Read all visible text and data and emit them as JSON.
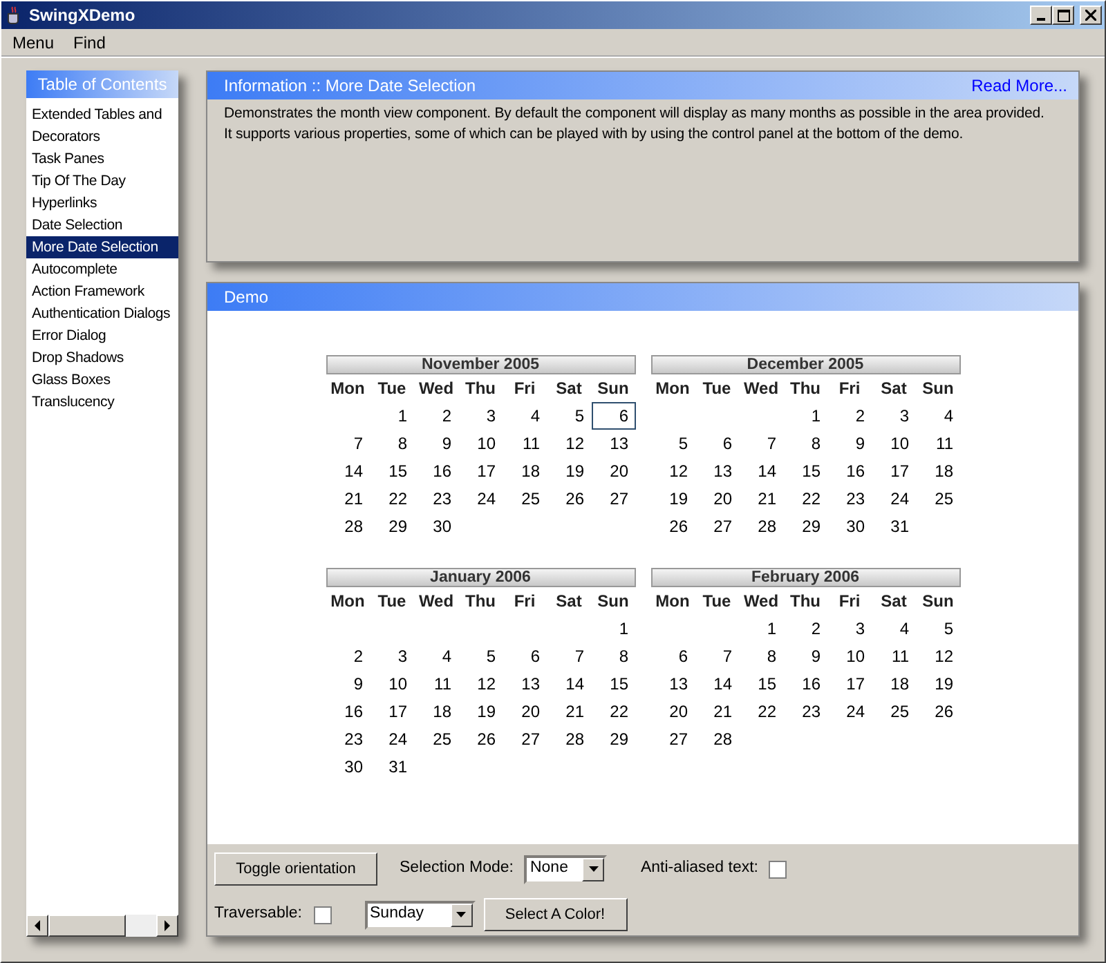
{
  "window": {
    "title": "SwingXDemo"
  },
  "menu": [
    "Menu",
    "Find"
  ],
  "sidebar": {
    "title": "Table of Contents",
    "items": [
      {
        "label": "Extended Tables and Decorators",
        "selected": false
      },
      {
        "label": "Task Panes",
        "selected": false
      },
      {
        "label": "Tip Of The Day",
        "selected": false
      },
      {
        "label": "Hyperlinks",
        "selected": false
      },
      {
        "label": "Date Selection",
        "selected": false
      },
      {
        "label": "More Date Selection",
        "selected": true
      },
      {
        "label": "Autocomplete",
        "selected": false
      },
      {
        "label": "Action Framework",
        "selected": false
      },
      {
        "label": "Authentication Dialogs",
        "selected": false
      },
      {
        "label": "Error Dialog",
        "selected": false
      },
      {
        "label": "Drop Shadows",
        "selected": false
      },
      {
        "label": "Glass Boxes",
        "selected": false
      },
      {
        "label": "Translucency",
        "selected": false
      }
    ]
  },
  "info": {
    "title": "Information :: More Date Selection",
    "link": "Read More...",
    "lines": [
      "Demonstrates the month view component. By default the component will display as many months as possible in the area provided.",
      "It supports various properties, some of which can be played with by using the control panel at the bottom of the demo."
    ]
  },
  "demo": {
    "title": "Demo",
    "months": [
      {
        "title": "November 2005",
        "weekdays": [
          "Mon",
          "Tue",
          "Wed",
          "Thu",
          "Fri",
          "Sat",
          "Sun"
        ],
        "weeks": [
          [
            "1",
            "2",
            "3",
            "4",
            "5",
            {
              "day": "6",
              "today": true
            }
          ],
          [
            "7",
            "8",
            "9",
            "10",
            "11",
            "12",
            "13"
          ],
          [
            "14",
            "15",
            "16",
            "17",
            "18",
            "19",
            "20"
          ],
          [
            "21",
            "22",
            "23",
            "24",
            "25",
            "26",
            "27"
          ],
          [
            "28",
            "29",
            "30"
          ]
        ]
      },
      {
        "title": "December 2005",
        "weekdays": [
          "Mon",
          "Tue",
          "Wed",
          "Thu",
          "Fri",
          "Sat",
          "Sun"
        ],
        "weeks": [
          [
            "1",
            "2",
            "3",
            "4"
          ],
          [
            "5",
            "6",
            "7",
            "8",
            "9",
            "10",
            "11"
          ],
          [
            "12",
            "13",
            "14",
            "15",
            "16",
            "17",
            "18"
          ],
          [
            "19",
            "20",
            "21",
            "22",
            "23",
            "24",
            "25"
          ],
          [
            "26",
            "27",
            "28",
            "29",
            "30",
            "31"
          ]
        ]
      },
      {
        "title": "January 2006",
        "weekdays": [
          "Mon",
          "Tue",
          "Wed",
          "Thu",
          "Fri",
          "Sat",
          "Sun"
        ],
        "weeks": [
          [
            "1"
          ],
          [
            "2",
            "3",
            "4",
            "5",
            "6",
            "7",
            "8"
          ],
          [
            "9",
            "10",
            "11",
            "12",
            "13",
            "14",
            "15"
          ],
          [
            "16",
            "17",
            "18",
            "19",
            "20",
            "21",
            "22"
          ],
          [
            "23",
            "24",
            "25",
            "26",
            "27",
            "28",
            "29"
          ],
          [
            "30",
            "31"
          ]
        ]
      },
      {
        "title": "February 2006",
        "weekdays": [
          "Mon",
          "Tue",
          "Wed",
          "Thu",
          "Fri",
          "Sat",
          "Sun"
        ],
        "weeks": [
          [
            "1",
            "2",
            "3",
            "4",
            "5"
          ],
          [
            "6",
            "7",
            "8",
            "9",
            "10",
            "11",
            "12"
          ],
          [
            "13",
            "14",
            "15",
            "16",
            "17",
            "18",
            "19"
          ],
          [
            "20",
            "21",
            "22",
            "23",
            "24",
            "25",
            "26"
          ],
          [
            "27",
            "28"
          ]
        ]
      }
    ],
    "controls": {
      "toggle_button": "Toggle orientation",
      "selection_mode_label": "Selection Mode:",
      "selection_mode": "None",
      "antialiased_label": "Anti-aliased text:",
      "antialiased_checked": false,
      "traversable_label": "Traversable:",
      "traversable_checked": false,
      "first_day": "Sunday",
      "color_button": "Select A Color!"
    }
  }
}
